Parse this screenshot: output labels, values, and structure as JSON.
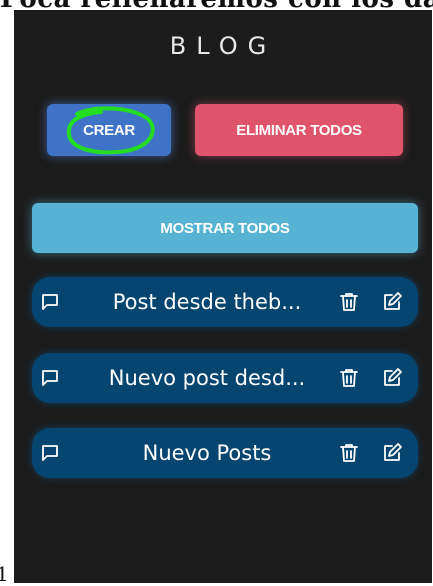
{
  "page_top_text": "Poca rellenaremos con los dat",
  "page_bottom_text": "1",
  "app": {
    "title": "BLOG"
  },
  "toolbar": {
    "create_label": "CREAR",
    "delete_all_label": "ELIMINAR TODOS",
    "show_all_label": "MOSTRAR TODOS"
  },
  "posts": [
    {
      "title": "Post desde theb..."
    },
    {
      "title": "Nuevo post desd..."
    },
    {
      "title": "Nuevo Posts"
    }
  ],
  "colors": {
    "panel": "#1c1c1c",
    "create": "#3e73c8",
    "delete": "#e0546b",
    "show": "#56b3d3",
    "post": "#054570",
    "annotation": "#22dd22"
  }
}
